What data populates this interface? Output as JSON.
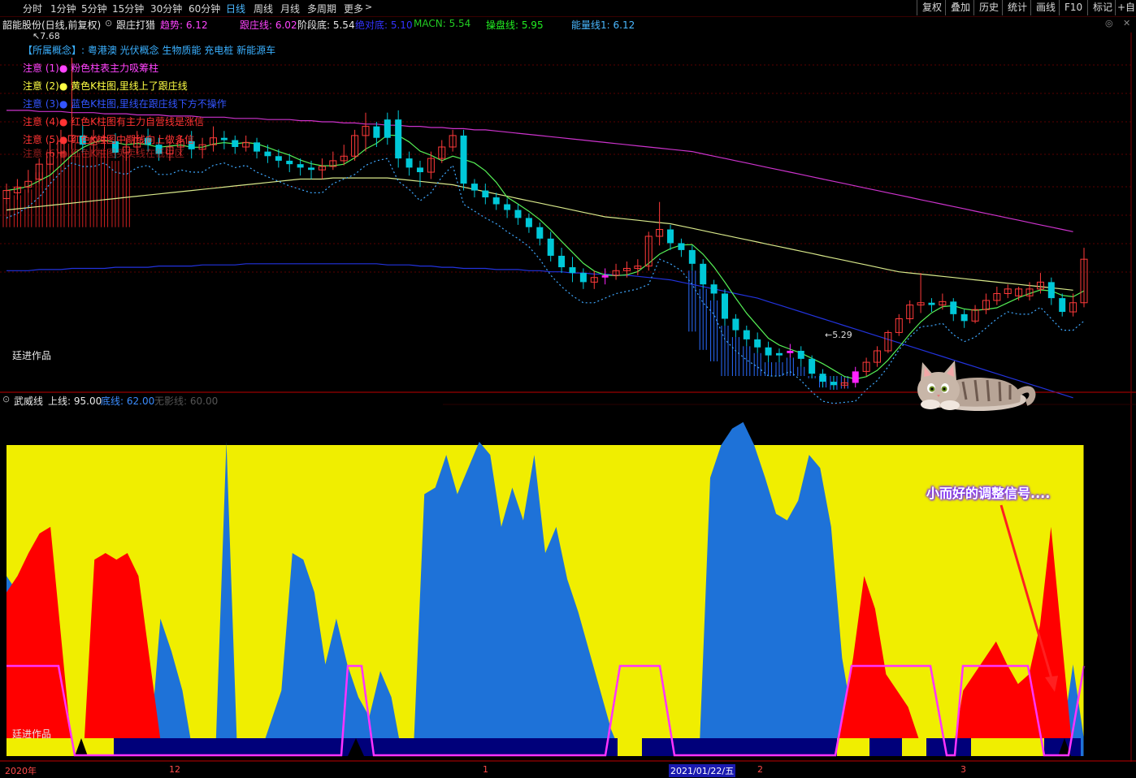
{
  "topbar": {
    "period_tabs": [
      "分时",
      "1分钟",
      "5分钟",
      "15分钟",
      "30分钟",
      "60分钟",
      "日线",
      "周线",
      "月线",
      "多周期",
      "更多"
    ],
    "active_tab": "日线",
    "more_chevron": "chevron-right-icon",
    "right_buttons": [
      "复权",
      "叠加",
      "历史",
      "统计",
      "画线",
      "F10",
      "标记",
      "+自选"
    ]
  },
  "infobar": {
    "stock_name": "韶能股份(日线,前复权)",
    "indicator_name": "跟庄打猎",
    "trend": "趋势: 6.12",
    "follow_line": "跟庄线: 6.02",
    "stage_bottom": "阶段底: 5.54",
    "absolute_bottom": "绝对底: 5.10",
    "macn": "MACN: 5.54",
    "operate_line": "操盘线: 5.95",
    "energy_line": "能量线1: 6.12",
    "colors": {
      "name": "#e8e8e8",
      "trend": "#ff44ff",
      "follow": "#ff44ff",
      "stage": "#e8e8e8",
      "absolute": "#3333ff",
      "macn": "#22cc22",
      "operate": "#22ee22",
      "energy": "#4ab8ff"
    }
  },
  "main_chart": {
    "high_label": "7.68",
    "low_label": "5.29",
    "concepts": "【所属概念】: 粤港澳 光伏概念 生物质能 充电桩 新能源车",
    "notes": [
      {
        "text": "注意 (1)●  粉色柱表主力吸筹柱",
        "color": "#ff44ff"
      },
      {
        "text": "注意 (2)●  黄色K柱图,里线上了跟庄线",
        "color": "#ffff44"
      },
      {
        "text": "注意 (3)●  蓝色K柱图,里线在跟庄线下方不操作",
        "color": "#3355ff"
      },
      {
        "text": "注意 (4)●  红色K柱图有主力自营线是涨信",
        "color": "#ff3333"
      },
      {
        "text": "注意 (5)●  红色K柱图中期线向上做多信",
        "color": "#ff3333"
      },
      {
        "text": "注意 (6)●  红色K柱图买卖线在低位区",
        "color": "#ff3333"
      }
    ],
    "author": "廷进作品",
    "ylim": [
      4.9,
      7.9
    ],
    "candles": [
      [
        6.45,
        6.52,
        6.4,
        6.58,
        "r"
      ],
      [
        6.5,
        6.55,
        6.44,
        6.62,
        "r"
      ],
      [
        6.55,
        6.6,
        6.5,
        6.7,
        "r"
      ],
      [
        6.62,
        6.75,
        6.58,
        6.8,
        "r"
      ],
      [
        6.75,
        6.85,
        6.7,
        6.95,
        "r"
      ],
      [
        6.85,
        6.95,
        6.8,
        7.05,
        "r"
      ],
      [
        6.95,
        7.0,
        6.88,
        7.68,
        "r"
      ],
      [
        7.0,
        6.92,
        6.85,
        7.1,
        "c"
      ],
      [
        6.92,
        6.98,
        6.85,
        7.05,
        "r"
      ],
      [
        6.98,
        6.95,
        6.88,
        7.08,
        "r"
      ],
      [
        6.95,
        6.85,
        6.8,
        7.02,
        "c"
      ],
      [
        6.85,
        6.9,
        6.78,
        6.98,
        "r"
      ],
      [
        6.9,
        6.98,
        6.84,
        7.04,
        "r"
      ],
      [
        6.98,
        6.92,
        6.86,
        7.06,
        "c"
      ],
      [
        6.92,
        6.84,
        6.78,
        6.98,
        "c"
      ],
      [
        6.84,
        6.9,
        6.78,
        6.95,
        "r"
      ],
      [
        6.9,
        6.95,
        6.82,
        7.0,
        "r"
      ],
      [
        6.95,
        6.88,
        6.8,
        7.04,
        "c"
      ],
      [
        6.88,
        6.92,
        6.8,
        6.98,
        "r"
      ],
      [
        6.92,
        6.98,
        6.86,
        7.08,
        "r"
      ],
      [
        6.98,
        6.96,
        6.88,
        7.04,
        "c"
      ],
      [
        6.96,
        6.9,
        6.84,
        7.0,
        "c"
      ],
      [
        6.9,
        6.94,
        6.86,
        7.0,
        "r"
      ],
      [
        6.94,
        6.86,
        6.8,
        6.98,
        "c"
      ],
      [
        6.86,
        6.82,
        6.76,
        6.92,
        "c"
      ],
      [
        6.82,
        6.78,
        6.72,
        6.88,
        "c"
      ],
      [
        6.78,
        6.75,
        6.68,
        6.84,
        "c"
      ],
      [
        6.75,
        6.72,
        6.65,
        6.8,
        "c"
      ],
      [
        6.72,
        6.7,
        6.62,
        6.78,
        "c"
      ],
      [
        6.7,
        6.73,
        6.62,
        6.8,
        "r"
      ],
      [
        6.73,
        6.78,
        6.7,
        6.86,
        "r"
      ],
      [
        6.78,
        6.82,
        6.74,
        6.92,
        "r"
      ],
      [
        6.82,
        7.0,
        6.78,
        7.05,
        "r"
      ],
      [
        7.0,
        7.08,
        6.86,
        7.2,
        "r"
      ],
      [
        7.08,
        6.98,
        6.9,
        7.12,
        "c"
      ],
      [
        6.98,
        7.14,
        6.92,
        7.2,
        "c"
      ],
      [
        7.14,
        6.8,
        6.72,
        7.22,
        "c"
      ],
      [
        6.8,
        6.72,
        6.65,
        6.86,
        "c"
      ],
      [
        6.72,
        6.68,
        6.55,
        6.78,
        "c"
      ],
      [
        6.68,
        6.8,
        6.62,
        6.86,
        "r"
      ],
      [
        6.8,
        6.9,
        6.76,
        6.96,
        "r"
      ],
      [
        6.9,
        7.0,
        6.86,
        7.05,
        "r"
      ],
      [
        7.0,
        6.58,
        6.52,
        7.05,
        "c"
      ],
      [
        6.58,
        6.52,
        6.46,
        6.62,
        "c"
      ],
      [
        6.52,
        6.46,
        6.4,
        6.58,
        "c"
      ],
      [
        6.46,
        6.4,
        6.35,
        6.5,
        "c"
      ],
      [
        6.4,
        6.35,
        6.28,
        6.45,
        "c"
      ],
      [
        6.35,
        6.28,
        6.22,
        6.4,
        "c"
      ],
      [
        6.28,
        6.2,
        6.15,
        6.32,
        "c"
      ],
      [
        6.2,
        6.1,
        6.04,
        6.24,
        "c"
      ],
      [
        6.1,
        5.95,
        5.9,
        6.16,
        "c"
      ],
      [
        5.95,
        5.85,
        5.8,
        6.02,
        "c"
      ],
      [
        5.85,
        5.8,
        5.72,
        5.94,
        "c"
      ],
      [
        5.8,
        5.72,
        5.66,
        5.84,
        "c"
      ],
      [
        5.72,
        5.76,
        5.66,
        5.82,
        "r"
      ],
      [
        5.76,
        5.78,
        5.7,
        5.84,
        "m"
      ],
      [
        5.78,
        5.82,
        5.74,
        5.88,
        "r"
      ],
      [
        5.82,
        5.84,
        5.76,
        5.9,
        "r"
      ],
      [
        5.84,
        5.86,
        5.78,
        5.92,
        "r"
      ],
      [
        5.86,
        6.12,
        5.82,
        6.16,
        "r"
      ],
      [
        6.12,
        6.18,
        6.04,
        6.42,
        "r"
      ],
      [
        6.18,
        6.06,
        6.0,
        6.22,
        "c"
      ],
      [
        6.06,
        6.0,
        5.94,
        6.1,
        "c"
      ],
      [
        6.0,
        5.88,
        5.82,
        6.04,
        "c"
      ],
      [
        5.88,
        5.7,
        5.66,
        5.92,
        "c"
      ],
      [
        5.7,
        5.62,
        5.56,
        5.74,
        "c"
      ],
      [
        5.62,
        5.4,
        5.34,
        5.66,
        "c"
      ],
      [
        5.4,
        5.3,
        5.24,
        5.44,
        "c"
      ],
      [
        5.3,
        5.22,
        5.16,
        5.34,
        "c"
      ],
      [
        5.22,
        5.15,
        5.1,
        5.28,
        "c"
      ],
      [
        5.15,
        5.08,
        5.02,
        5.2,
        "c"
      ],
      [
        5.08,
        5.1,
        5.02,
        5.14,
        "c"
      ],
      [
        5.1,
        5.12,
        5.06,
        5.18,
        "m"
      ],
      [
        5.12,
        5.05,
        4.98,
        5.16,
        "c"
      ],
      [
        5.05,
        4.92,
        4.88,
        5.08,
        "c"
      ],
      [
        4.92,
        4.85,
        4.8,
        4.96,
        "c"
      ],
      [
        4.85,
        4.82,
        4.78,
        4.9,
        "c"
      ],
      [
        4.82,
        4.84,
        4.79,
        4.88,
        "r"
      ],
      [
        4.84,
        4.94,
        4.8,
        4.98,
        "m"
      ],
      [
        4.94,
        5.02,
        4.9,
        5.06,
        "r"
      ],
      [
        5.02,
        5.12,
        4.98,
        5.16,
        "r"
      ],
      [
        5.12,
        5.28,
        5.1,
        5.3,
        "r"
      ],
      [
        5.28,
        5.4,
        5.25,
        5.44,
        "r"
      ],
      [
        5.4,
        5.52,
        5.36,
        5.56,
        "r"
      ],
      [
        5.52,
        5.54,
        5.45,
        5.8,
        "r"
      ],
      [
        5.54,
        5.52,
        5.46,
        5.58,
        "c"
      ],
      [
        5.52,
        5.55,
        5.48,
        5.62,
        "r"
      ],
      [
        5.55,
        5.44,
        5.38,
        5.58,
        "c"
      ],
      [
        5.44,
        5.38,
        5.32,
        5.48,
        "c"
      ],
      [
        5.38,
        5.48,
        5.36,
        5.52,
        "r"
      ],
      [
        5.48,
        5.56,
        5.44,
        5.62,
        "r"
      ],
      [
        5.56,
        5.62,
        5.52,
        5.68,
        "r"
      ],
      [
        5.62,
        5.66,
        5.58,
        5.7,
        "r"
      ],
      [
        5.66,
        5.6,
        5.56,
        5.68,
        "r"
      ],
      [
        5.6,
        5.66,
        5.56,
        5.72,
        "r"
      ],
      [
        5.66,
        5.72,
        5.62,
        5.8,
        "r"
      ],
      [
        5.72,
        5.58,
        5.52,
        5.76,
        "c"
      ],
      [
        5.58,
        5.46,
        5.42,
        5.62,
        "c"
      ],
      [
        5.46,
        5.54,
        5.42,
        5.62,
        "r"
      ],
      [
        5.54,
        5.92,
        5.5,
        6.02,
        "r"
      ]
    ],
    "ma_long": [
      6.35,
      6.36,
      6.37,
      6.38,
      6.39,
      6.4,
      6.41,
      6.42,
      6.43,
      6.44,
      6.45,
      6.46,
      6.47,
      6.48,
      6.49,
      6.5,
      6.51,
      6.52,
      6.53,
      6.54,
      6.55,
      6.56,
      6.57,
      6.58,
      6.59,
      6.6,
      6.61,
      6.62,
      6.62,
      6.62,
      6.63,
      6.63,
      6.63,
      6.63,
      6.63,
      6.63,
      6.62,
      6.61,
      6.6,
      6.59,
      6.58,
      6.57,
      6.55,
      6.53,
      6.51,
      6.49,
      6.47,
      6.45,
      6.43,
      6.41,
      6.39,
      6.37,
      6.35,
      6.33,
      6.31,
      6.29,
      6.28,
      6.27,
      6.26,
      6.25,
      6.24,
      6.23,
      6.21,
      6.19,
      6.17,
      6.15,
      6.13,
      6.11,
      6.09,
      6.07,
      6.05,
      6.03,
      6.01,
      5.99,
      5.97,
      5.95,
      5.93,
      5.91,
      5.89,
      5.87,
      5.85,
      5.83,
      5.81,
      5.8,
      5.79,
      5.78,
      5.77,
      5.76,
      5.75,
      5.74,
      5.73,
      5.72,
      5.71,
      5.7,
      5.69,
      5.68,
      5.67,
      5.66,
      5.65
    ],
    "energy_line": [
      7.22,
      7.22,
      7.22,
      7.21,
      7.21,
      7.21,
      7.2,
      7.2,
      7.2,
      7.19,
      7.19,
      7.19,
      7.18,
      7.18,
      7.18,
      7.17,
      7.17,
      7.17,
      7.16,
      7.16,
      7.16,
      7.15,
      7.15,
      7.15,
      7.14,
      7.14,
      7.14,
      7.13,
      7.13,
      7.12,
      7.12,
      7.11,
      7.11,
      7.1,
      7.1,
      7.09,
      7.09,
      7.08,
      7.08,
      7.07,
      7.07,
      7.06,
      7.06,
      7.05,
      7.05,
      7.04,
      7.03,
      7.02,
      7.01,
      7.0,
      6.99,
      6.98,
      6.97,
      6.96,
      6.95,
      6.94,
      6.93,
      6.92,
      6.91,
      6.9,
      6.89,
      6.88,
      6.87,
      6.86,
      6.84,
      6.82,
      6.8,
      6.78,
      6.76,
      6.74,
      6.72,
      6.7,
      6.68,
      6.66,
      6.64,
      6.62,
      6.6,
      6.58,
      6.56,
      6.54,
      6.52,
      6.5,
      6.48,
      6.46,
      6.44,
      6.42,
      6.4,
      6.38,
      6.36,
      6.34,
      6.32,
      6.3,
      6.28,
      6.26,
      6.24,
      6.22,
      6.2,
      6.18,
      6.16
    ],
    "blue_line": [
      5.82,
      5.82,
      5.82,
      5.83,
      5.83,
      5.83,
      5.84,
      5.84,
      5.84,
      5.84,
      5.85,
      5.85,
      5.85,
      5.85,
      5.86,
      5.86,
      5.86,
      5.86,
      5.87,
      5.87,
      5.87,
      5.87,
      5.88,
      5.88,
      5.88,
      5.88,
      5.88,
      5.88,
      5.88,
      5.88,
      5.88,
      5.88,
      5.88,
      5.88,
      5.88,
      5.87,
      5.87,
      5.87,
      5.86,
      5.86,
      5.85,
      5.85,
      5.84,
      5.84,
      5.84,
      5.83,
      5.83,
      5.83,
      5.82,
      5.82,
      5.81,
      5.81,
      5.8,
      5.8,
      5.79,
      5.79,
      5.78,
      5.78,
      5.77,
      5.76,
      5.75,
      5.74,
      5.72,
      5.7,
      5.68,
      5.66,
      5.64,
      5.62,
      5.6,
      5.58,
      5.55,
      5.52,
      5.49,
      5.46,
      5.43,
      5.4,
      5.37,
      5.34,
      5.31,
      5.28,
      5.25,
      5.22,
      5.19,
      5.16,
      5.13,
      5.1,
      5.07,
      5.04,
      5.01,
      4.98,
      4.95,
      4.92,
      4.89,
      4.86,
      4.83,
      4.8,
      4.77,
      4.74,
      4.71
    ]
  },
  "indicator": {
    "name": "武威线",
    "upper": "上线: 95.00",
    "bottom": "底线: 62.00",
    "neutral": "无影线: 60.00",
    "author": "廷进作品",
    "callout": "小而好的调整信号....",
    "blue_series": [
      55,
      50,
      15,
      52,
      45,
      20,
      0,
      0,
      0,
      0,
      25,
      10,
      2,
      0,
      42,
      32,
      20,
      0,
      0,
      0,
      96,
      0,
      0,
      0,
      10,
      20,
      62,
      60,
      50,
      28,
      42,
      28,
      18,
      12,
      26,
      18,
      0,
      0,
      80,
      82,
      92,
      80,
      88,
      96,
      92,
      70,
      82,
      72,
      92,
      62,
      70,
      54,
      44,
      32,
      20,
      8,
      0,
      0,
      0,
      0,
      0,
      0,
      0,
      0,
      85,
      95,
      100,
      102,
      95,
      85,
      74,
      72,
      78,
      92,
      88,
      70,
      30,
      10,
      0,
      0,
      0,
      0,
      0,
      0,
      0,
      0,
      0,
      0,
      0,
      0,
      0,
      0,
      0,
      0,
      0,
      0,
      5,
      28,
      5
    ],
    "red_series": [
      50,
      55,
      62,
      68,
      70,
      35,
      0,
      0,
      60,
      62,
      60,
      62,
      55,
      30,
      5,
      0,
      0,
      0,
      0,
      0,
      0,
      0,
      0,
      0,
      0,
      0,
      0,
      0,
      0,
      0,
      0,
      0,
      0,
      0,
      0,
      0,
      0,
      0,
      0,
      0,
      0,
      0,
      0,
      0,
      0,
      0,
      0,
      0,
      0,
      0,
      0,
      0,
      0,
      0,
      0,
      0,
      0,
      0,
      0,
      0,
      0,
      0,
      0,
      0,
      0,
      0,
      0,
      0,
      0,
      0,
      0,
      0,
      0,
      0,
      0,
      0,
      10,
      30,
      55,
      45,
      25,
      20,
      15,
      5,
      0,
      0,
      0,
      20,
      25,
      30,
      35,
      28,
      22,
      25,
      40,
      70,
      35,
      0,
      0
    ]
  },
  "date_axis": {
    "labels": [
      "2020年",
      "12",
      "1",
      "2",
      "3"
    ],
    "crosshair_date": "2021/01/22/五"
  }
}
